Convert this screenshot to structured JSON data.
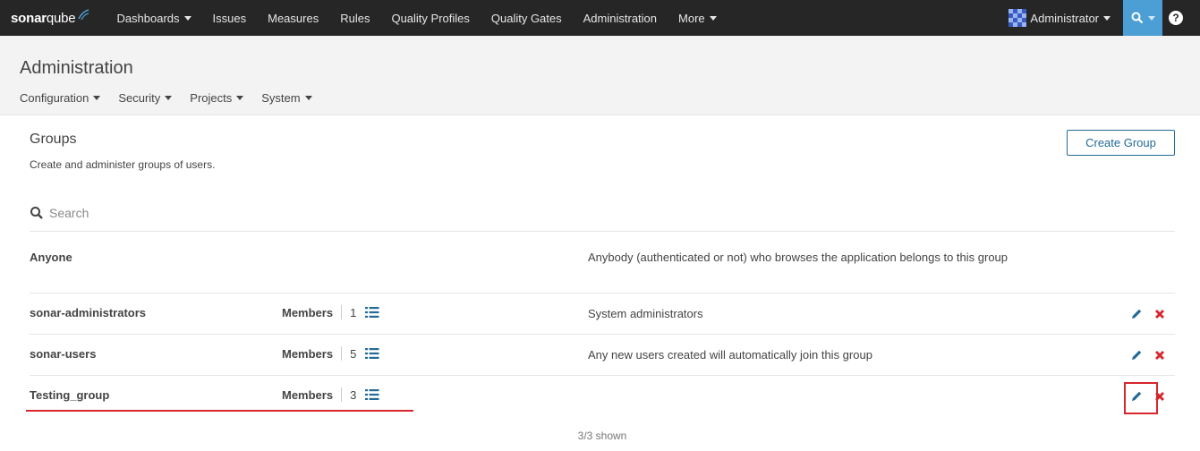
{
  "colors": {
    "nav_bg": "#262626",
    "accent": "#4b9fd5",
    "link": "#236a97",
    "delete": "#d8262e",
    "header_bg": "#f3f3f3"
  },
  "topnav": {
    "logo_bold": "sonar",
    "logo_light": "qube",
    "items": [
      {
        "label": "Dashboards",
        "dropdown": true
      },
      {
        "label": "Issues",
        "dropdown": false
      },
      {
        "label": "Measures",
        "dropdown": false
      },
      {
        "label": "Rules",
        "dropdown": false
      },
      {
        "label": "Quality Profiles",
        "dropdown": false
      },
      {
        "label": "Quality Gates",
        "dropdown": false
      },
      {
        "label": "Administration",
        "dropdown": false
      },
      {
        "label": "More",
        "dropdown": true
      }
    ],
    "user_label": "Administrator",
    "help_label": "?"
  },
  "page_header": {
    "title": "Administration",
    "subnav": [
      {
        "label": "Configuration"
      },
      {
        "label": "Security"
      },
      {
        "label": "Projects"
      },
      {
        "label": "System"
      }
    ]
  },
  "groups": {
    "title": "Groups",
    "description": "Create and administer groups of users.",
    "create_button": "Create Group",
    "search_placeholder": "Search",
    "members_label": "Members",
    "rows": [
      {
        "name": "Anyone",
        "members": null,
        "description": "Anybody (authenticated or not) who browses the application belongs to this group"
      },
      {
        "name": "sonar-administrators",
        "members": "1",
        "description": "System administrators"
      },
      {
        "name": "sonar-users",
        "members": "5",
        "description": "Any new users created will automatically join this group"
      },
      {
        "name": "Testing_group",
        "members": "3",
        "description": ""
      }
    ],
    "shown_count": "3/3 shown"
  },
  "icons": {
    "search": "search-icon",
    "list": "list-icon",
    "edit": "pencil-icon",
    "delete": "close-icon",
    "help": "question-icon"
  }
}
